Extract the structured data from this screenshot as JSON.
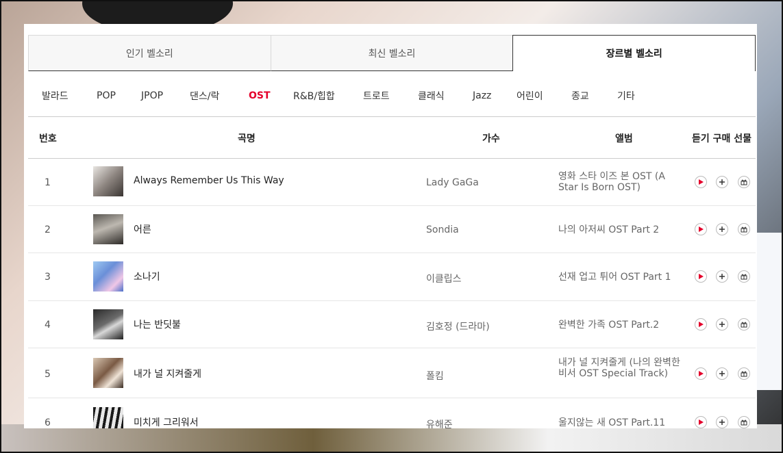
{
  "tabs": [
    {
      "label": "인기 벨소리"
    },
    {
      "label": "최신 벨소리"
    },
    {
      "label": "장르별 벨소리"
    }
  ],
  "genres": [
    "발라드",
    "POP",
    "JPOP",
    "댄스/락",
    "OST",
    "R&B/힙합",
    "트로트",
    "클래식",
    "Jazz",
    "어린이",
    "종교",
    "기타"
  ],
  "active_genre": "OST",
  "table": {
    "headers": {
      "number": "번호",
      "title": "곡명",
      "artist": "가수",
      "album": "앨범",
      "actions": "듣기 구매 선물"
    },
    "rows": [
      {
        "num": "1",
        "title": "Always Remember Us This Way",
        "artist": "Lady GaGa",
        "album": "영화 스타 이즈 본 OST (A Star Is Born OST)"
      },
      {
        "num": "2",
        "title": "어른",
        "artist": "Sondia",
        "album": "나의 아저씨 OST Part 2"
      },
      {
        "num": "3",
        "title": "소나기",
        "artist": "이클립스",
        "album": "선재 업고 튀어 OST Part 1"
      },
      {
        "num": "4",
        "title": "나는 반딧불",
        "artist": "김호정 (드라마)",
        "album": "완벽한 가족 OST Part.2"
      },
      {
        "num": "5",
        "title": "내가 널 지켜줄게",
        "artist": "폴킴",
        "album": "내가 널 지켜줄게 (나의 완벽한 비서 OST Special Track)"
      },
      {
        "num": "6",
        "title": "미치게 그리워서",
        "artist": "유해준",
        "album": "울지않는 새 OST Part.11"
      }
    ]
  },
  "icons": {
    "play": "play-icon",
    "buy": "plus-icon",
    "gift": "gift-icon"
  },
  "colors": {
    "accent": "#e4002b"
  }
}
